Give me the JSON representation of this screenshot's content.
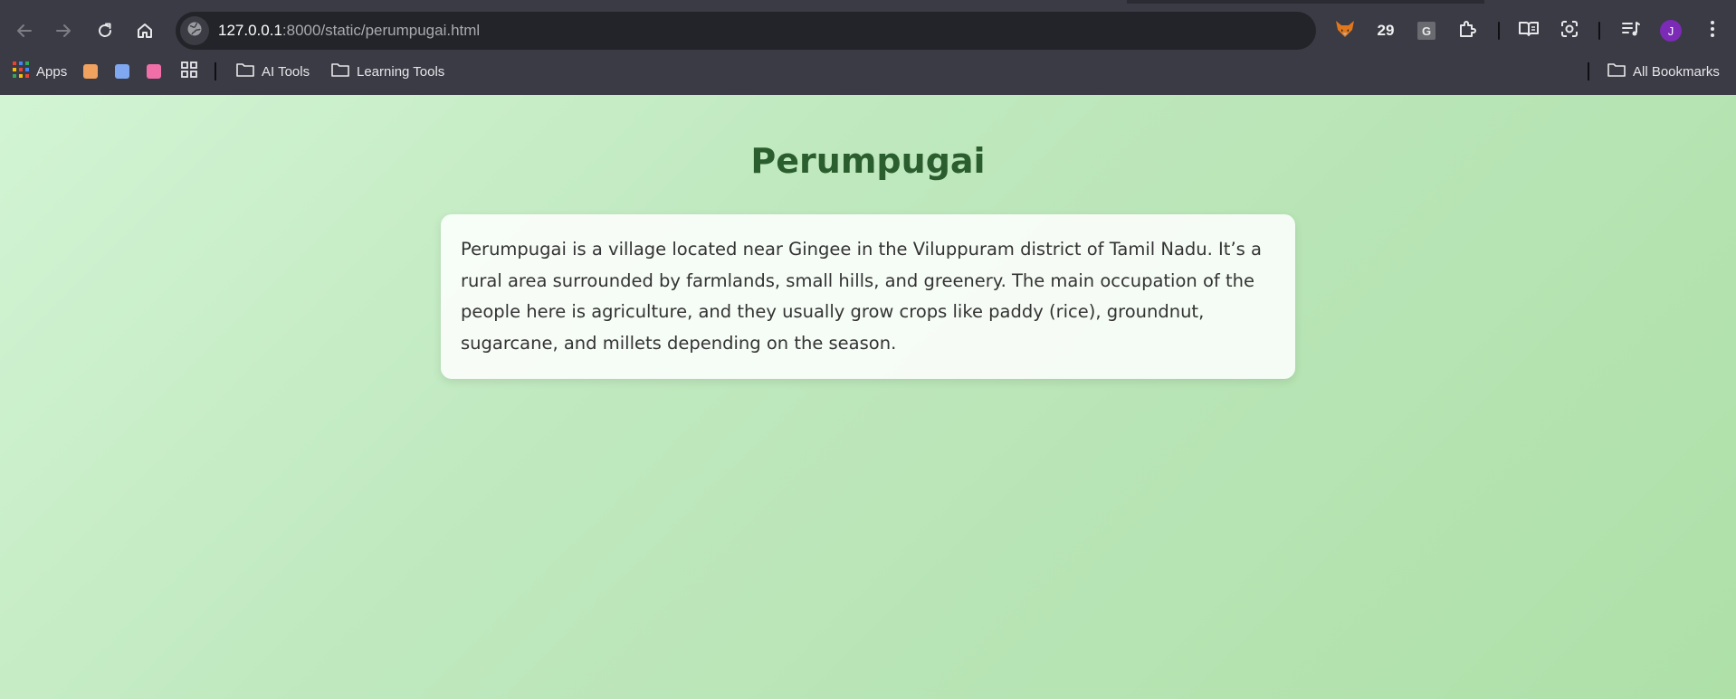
{
  "browser": {
    "url_host": "127.0.0.1",
    "url_rest": ":8000/static/perumpugai.html",
    "extension_badge_count": "29",
    "extension_letter": "G",
    "profile_initial": "J"
  },
  "bookmarks": {
    "apps_label": "Apps",
    "items": [
      {
        "label": "AI Tools"
      },
      {
        "label": "Learning Tools"
      }
    ],
    "all_bookmarks_label": "All Bookmarks"
  },
  "icons": {
    "back": "back-arrow-icon",
    "forward": "forward-arrow-icon",
    "reload": "reload-icon",
    "home": "home-icon",
    "site_info": "site-info-icon",
    "extensions": [
      "fox-extension-icon",
      "extension-counter",
      "g-extension-icon",
      "puzzle-icon"
    ],
    "reading_mode": "reading-mode-icon",
    "lens": "lens-icon",
    "media": "media-control-icon",
    "menu": "kebab-menu-icon"
  },
  "colors": {
    "chrome_bg": "#3a3b45",
    "omnibox_bg": "#232429",
    "page_gradient_start": "#d2f4d3",
    "page_gradient_end": "#aee0a8",
    "title_color": "#2b5e2f",
    "avatar": "#7b2bb5"
  },
  "page": {
    "title": "Perumpugai",
    "description": "Perumpugai is a village located near Gingee in the Viluppuram district of Tamil Nadu. It’s a rural area surrounded by farmlands, small hills, and greenery. The main occupation of the people here is agriculture, and they usually grow crops like paddy (rice), groundnut, sugarcane, and millets depending on the season."
  }
}
